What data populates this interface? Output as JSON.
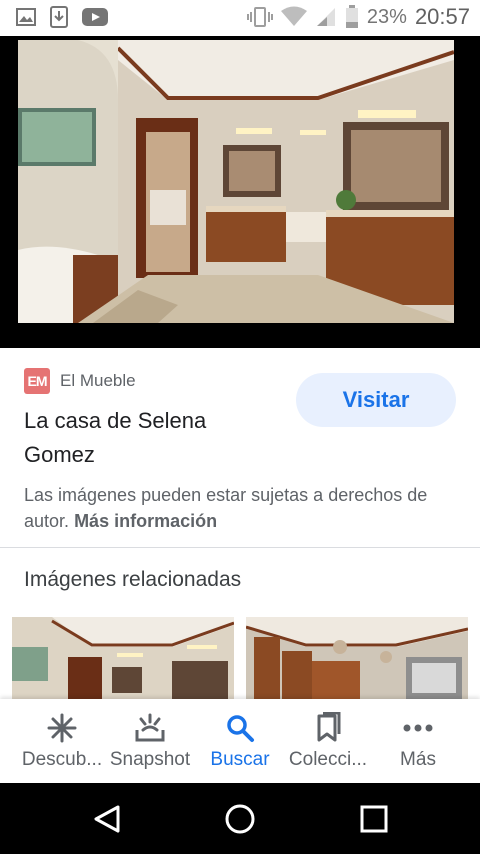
{
  "status_bar": {
    "battery": "23%",
    "time": "20:57"
  },
  "result": {
    "source_name": "El Mueble",
    "source_logo_text": "EM",
    "title": "La casa de Selena Gomez",
    "visit_label": "Visitar",
    "copyright_text": "Las imágenes pueden estar sujetas a derechos de autor.",
    "more_info_label": "Más información"
  },
  "related": {
    "heading": "Imágenes relacionadas"
  },
  "bottom_nav": {
    "items": [
      {
        "label": "Descub...",
        "icon": "discover-icon"
      },
      {
        "label": "Snapshot",
        "icon": "snapshot-icon"
      },
      {
        "label": "Buscar",
        "icon": "search-icon"
      },
      {
        "label": "Colecci...",
        "icon": "collections-icon"
      },
      {
        "label": "Más",
        "icon": "more-icon"
      }
    ],
    "active_index": 2
  },
  "colors": {
    "accent": "#1a73e8",
    "visit_bg": "#e8f0fe",
    "logo_bg": "#e57373"
  }
}
